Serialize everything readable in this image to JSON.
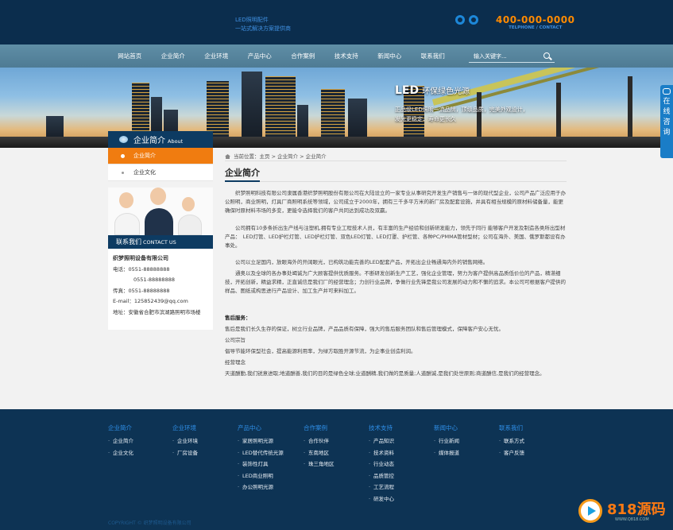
{
  "header": {
    "slogan_line1": "LED照明配件",
    "slogan_line2": "一站式解决方案提供商",
    "phone": "400-000-0000",
    "phone_sub": "TELPHONE / CONTACT"
  },
  "nav": {
    "items": [
      "网站首页",
      "企业简介",
      "企业环境",
      "产品中心",
      "合作案例",
      "技术支持",
      "新闻中心",
      "联系我们"
    ],
    "search_placeholder": "输入关键字..."
  },
  "banner": {
    "title": "LED",
    "title_rest": "环保绿色光源",
    "sub1": "正品级LED照明一流品牌，顶级品质，完美外观设计，",
    "sub2": "发光更稳定、寿命更长久"
  },
  "online_service": [
    "在",
    "线",
    "咨",
    "询"
  ],
  "sidebar": {
    "title": "企业简介",
    "title_en": "About",
    "items": [
      {
        "label": "企业简介",
        "active": true
      },
      {
        "label": "企业文化",
        "active": false
      }
    ],
    "contact_title": "联系我们",
    "contact_title_en": "CONTACT US",
    "company": "织梦照明设备有限公司",
    "phone1": "电话：0551-88888888",
    "phone2": "0551-88888888",
    "fax": "传真：0551-88888888",
    "email": "E-mail：125852439@qq.com",
    "address": "地址：安徽省合肥市滨湖路照明市场楼"
  },
  "main": {
    "breadcrumb": "当前位置：主页 > 企业简介 > 企业简介",
    "title": "企业简介",
    "paragraphs": [
      "织梦照明科技有限公司隶属香港织梦照明股份有限公司在大陆设立的一家专业从事研究开发生产销售与一体的现代型企业，公司产品广泛应用于办公照明，商业照明，灯具厂商照明系统等领域，公司成立于2000年，拥有三千多平方米的新厂房及配套设施，并具有相当规模的原材料储备量，能更确保时原材料市场的多变，更能令选择我们的客户共同达到成功及双赢。",
      "公司拥有10多条折出生产线与注塑机,拥有专业工程技术人员，有丰富的生产经验和创新研发能力，领先于同行 能够客户开发及制造各类所出型材产品：　LED灯管、LED护栏灯管、LED护栏灯管、双色LED灯管、LED灯罩、护栏管、各种PC/PMMA管材型材；公司在海外、美国、俄罗斯都设有办事处。",
      "公司以立足国内，放眼海外的开阔眼光，已构筑功能完善的LED配套产品，开拓出企业畅通海内外的销售网络。",
      "通奥以及全球的各办事处竭诚为广大顾客提供优质服务。不断研发创新生产工艺，强化企业管理，努力为客户提供高品质低价位的产品，精湛细技，开拓创新，精益求精，正直诚信是我们厂的经营理念；力创行业品牌，争做行业先锋是我公司发展的动力和不懈的追求。本公司可根据客户提供的样品、图纸或构思进行产品设计、加工生产并可来料加工。"
    ],
    "after_sale_title": "售后服务：",
    "after_sale_text": "售后是我们长久生存的保证，树立行业品牌，产品品质有保障，强大的售后服务团队和售后管理模式，保障客户安心无忧。",
    "purpose_title": "公司宗旨",
    "purpose_text": "倡导节能环保型社会，提高能源利用率，为绿方取胜开源节流，为企事业创造利润。",
    "concept_title": "经营理念",
    "concept_text": "天道酬勤,我们锐意进取;地道酬善,我们的目的是绿色全球;业道酬精,我们做的是质量;人道酬诚,是我们处世原则;商道酬信,是我们的经营理念。"
  },
  "footer": {
    "columns": [
      {
        "title": "企业简介",
        "items": [
          "企业简介",
          "企业文化"
        ]
      },
      {
        "title": "企业环境",
        "items": [
          "企业环境",
          "厂房设备"
        ]
      },
      {
        "title": "产品中心",
        "items": [
          "家居照明光源",
          "LED替代传统光源",
          "装饰性灯具",
          "LED商业照明",
          "办公照明光源"
        ]
      },
      {
        "title": "合作案例",
        "items": [
          "合作伙伴",
          "东南地区",
          "珠三角地区"
        ]
      },
      {
        "title": "技术支持",
        "items": [
          "产品知识",
          "技术资料",
          "行业动态",
          "品质管控",
          "工艺流程",
          "研发中心"
        ]
      },
      {
        "title": "新闻中心",
        "items": [
          "行业新闻",
          "媒体报道"
        ]
      },
      {
        "title": "联系我们",
        "items": [
          "联系方式",
          "客户反馈"
        ]
      }
    ],
    "copyright": "COPYRIGHT © 织梦照明设备有限公司"
  },
  "watermark": {
    "text": "818源码",
    "url": "WWW.Q818.COM"
  },
  "colors": {
    "header_bg": "#0b2d4d",
    "nav_bg": "#5f8ea6",
    "accent_orange": "#f07c10",
    "sidebar_head": "#0d3b62",
    "footer_bg": "#0d3354",
    "footer_heading": "#2f8fe8"
  }
}
